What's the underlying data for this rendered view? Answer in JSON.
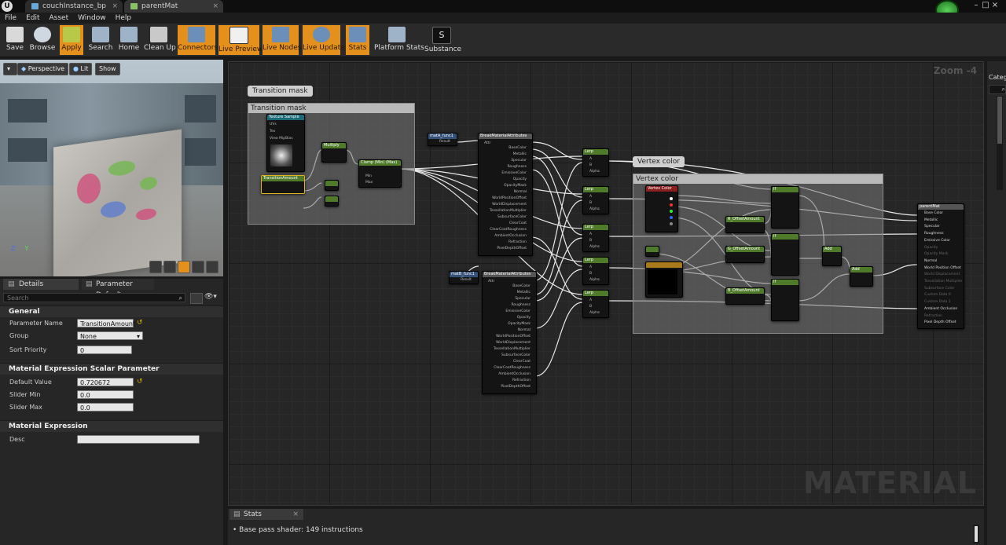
{
  "window": {
    "tabs": [
      {
        "label": "couchInstance_bp"
      },
      {
        "label": "parentMat"
      }
    ]
  },
  "menu": [
    "File",
    "Edit",
    "Asset",
    "Window",
    "Help"
  ],
  "toolbar": [
    {
      "label": "Save",
      "icon": "save-icon",
      "active": false
    },
    {
      "label": "Browse",
      "icon": "browse-icon",
      "active": false
    },
    {
      "label": "Apply",
      "icon": "apply-icon",
      "active": true
    },
    {
      "label": "Search",
      "icon": "search-icon",
      "active": false
    },
    {
      "label": "Home",
      "icon": "home-icon",
      "active": false
    },
    {
      "label": "Clean Up",
      "icon": "clean-up-icon",
      "active": false
    },
    {
      "label": "Connectors",
      "icon": "connectors-icon",
      "active": true
    },
    {
      "label": "Live Preview",
      "icon": "live-preview-icon",
      "active": true
    },
    {
      "label": "Live Nodes",
      "icon": "live-nodes-icon",
      "active": true
    },
    {
      "label": "Live Update",
      "icon": "live-update-icon",
      "active": true
    },
    {
      "label": "Stats",
      "icon": "stats-icon",
      "active": true
    },
    {
      "label": "Platform Stats",
      "icon": "platform-stats-icon",
      "active": false
    },
    {
      "label": "Substance",
      "icon": "substance-icon",
      "active": false
    }
  ],
  "viewport": {
    "perspective": "Perspective",
    "lit": "Lit",
    "show": "Show"
  },
  "details": {
    "tab_details": "Details",
    "tab_param_defaults": "Parameter Defaults",
    "search_placeholder": "Search",
    "section_general": "General",
    "param_name_label": "Parameter Name",
    "param_name_value": "TransitionAmount",
    "group_label": "Group",
    "group_value": "None",
    "sort_label": "Sort Priority",
    "sort_value": "0",
    "section_scalar": "Material Expression Scalar Parameter",
    "default_label": "Default Value",
    "default_value": "0.720672",
    "slider_min_label": "Slider Min",
    "slider_min_value": "0.0",
    "slider_max_label": "Slider Max",
    "slider_max_value": "0.0",
    "section_expression": "Material Expression",
    "desc_label": "Desc",
    "desc_value": ""
  },
  "graph": {
    "zoom": "Zoom -4",
    "watermark": "MATERIAL",
    "comments": {
      "transition_bubble": "Transition mask",
      "transition_head": "Transition mask",
      "vertex_bubble": "Vertex color",
      "vertex_head": "Vertex color"
    },
    "nodes": {
      "texture_sample": "Texture Sample",
      "ts_pins": [
        "UVs",
        "Tex",
        "View MipBias"
      ],
      "multiply": "Multiply",
      "transition_amount": "TransitionAmount",
      "clamp": "Clamp (Min) (Max)",
      "clamp_pins": [
        "Min",
        "Max"
      ],
      "mat_a": "matA_func1",
      "mat_b": "matB_func1",
      "result": "Result",
      "break_attr": "BreakMaterialAttributes",
      "attr_in": "Attr",
      "attr_outputs": [
        "BaseColor",
        "Metallic",
        "Specular",
        "Roughness",
        "EmissiveColor",
        "Opacity",
        "OpacityMask",
        "Normal",
        "WorldPositionOffset",
        "WorldDisplacement",
        "TessellationMultiplier",
        "SubsurfaceColor",
        "ClearCoat",
        "ClearCoatRoughness",
        "AmbientOcclusion",
        "Refraction",
        "PixelDepthOffset"
      ],
      "lerp": "Lerp",
      "lerp_pins": [
        "A",
        "B",
        "Alpha"
      ],
      "vertex_color": "Vertex Color",
      "if_node": "If",
      "if_pins": [
        "A",
        "B",
        "A > B",
        "A == B",
        "A < B"
      ],
      "offset_r": "R_OffsetAmount",
      "offset_g": "G_OffsetAmount",
      "offset_b": "B_OffsetAmount",
      "add": "Add",
      "output": "parentMat",
      "output_pins": [
        "Base Color",
        "Metallic",
        "Specular",
        "Roughness",
        "Emissive Color",
        "Opacity",
        "Opacity Mask",
        "Normal",
        "World Position Offset",
        "World Displacement",
        "Tessellation Multiplier",
        "Subsurface Color",
        "Custom Data 0",
        "Custom Data 1",
        "Ambient Occlusion",
        "Refraction",
        "Pixel Depth Offset"
      ]
    }
  },
  "stats": {
    "tab": "Stats",
    "line": "Base pass shader: 149 instructions"
  },
  "right_panel": {
    "label": "Categ"
  },
  "colors": {
    "accent_orange": "#e3901c",
    "node_green": "#4f7a2a",
    "node_teal": "#1b6a77",
    "node_blue": "#34517a"
  }
}
